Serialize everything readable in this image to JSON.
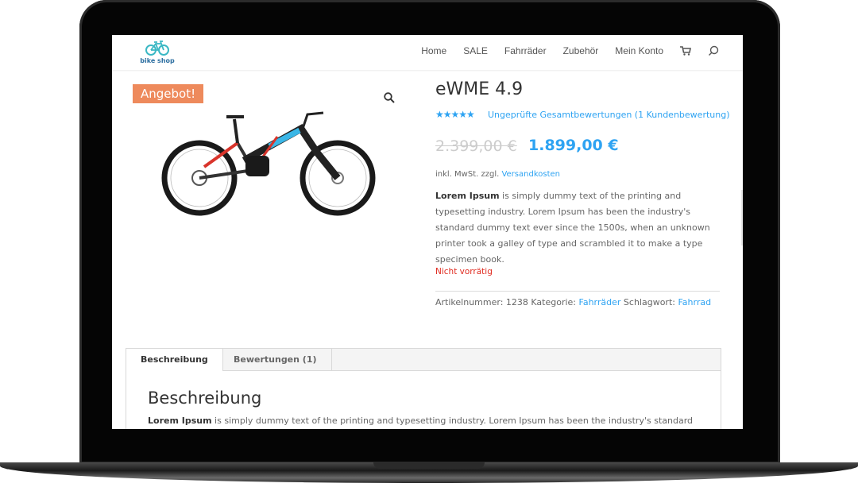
{
  "header": {
    "logo_text": "bike shop",
    "nav": [
      "Home",
      "SALE",
      "Fahrräder",
      "Zubehör",
      "Mein Konto"
    ]
  },
  "product": {
    "badge": "Angebot!",
    "title": "eWME 4.9",
    "rating_stars": 5,
    "review_link": "Ungeprüfte Gesamtbewertungen (1 Kundenbewertung)",
    "price_old": "2.399,00 €",
    "price_new": "1.899,00 €",
    "tax_prefix": "inkl. MwSt. zzgl.",
    "tax_link": "Versandkosten",
    "desc_bold": "Lorem Ipsum",
    "desc_rest": " is simply dummy text of the printing and typesetting industry. Lorem Ipsum has been the industry's standard dummy text ever since the 1500s, when an unknown printer took a galley of type and scrambled it to make a type specimen book.",
    "stock": "Nicht vorrätig",
    "meta_sku_label": "Artikelnummer:",
    "meta_sku": "1238",
    "meta_cat_label": "Kategorie:",
    "meta_cat": "Fahrräder",
    "meta_tag_label": "Schlagwort:",
    "meta_tag": "Fahrrad"
  },
  "tabs": {
    "items": [
      "Beschreibung",
      "Bewertungen (1)"
    ],
    "heading": "Beschreibung",
    "text_bold": "Lorem Ipsum",
    "text_rest": " is simply dummy text of the printing and typesetting industry. Lorem Ipsum has been the industry's standard"
  },
  "colors": {
    "accent": "#2ea3f2",
    "badge": "#ee8a5c",
    "stock": "#e02b20"
  },
  "icons": {
    "cart": "cart-icon",
    "search": "search-icon",
    "zoom": "zoom-icon",
    "logo": "bicycle-icon"
  }
}
